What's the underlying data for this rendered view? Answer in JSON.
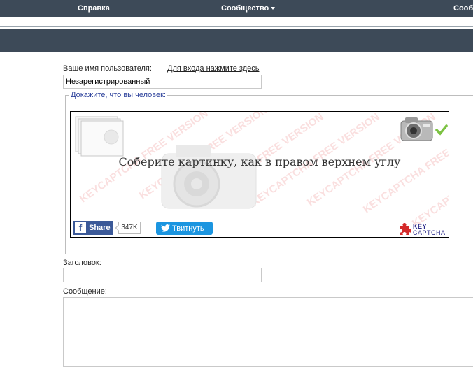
{
  "nav": {
    "items": [
      {
        "label": "Справка"
      },
      {
        "label": "Сообщество"
      },
      {
        "label": "Сооб"
      }
    ]
  },
  "form": {
    "username_label": "Ваше имя пользователя:",
    "login_link": "Для входа нажмите здесь",
    "username_value": "Незарегистрированный",
    "captcha_legend": "Докажите, что вы человек:",
    "subject_label": "Заголовок:",
    "subject_value": "",
    "message_label": "Сообщение:",
    "message_value": ""
  },
  "captcha": {
    "instruction": "Соберите картинку, как в правом верхнем углу",
    "watermark": "KEYCAPTCHA FREE VERSION",
    "share_label": "Share",
    "share_count": "347K",
    "tweet_label": "Твитнуть",
    "logo_line1": "KEY",
    "logo_line2": "CAPTCHA",
    "colors": {
      "facebook": "#3b5998",
      "twitter": "#1b95e0",
      "check": "#7cc242",
      "watermark": "#e15050"
    }
  },
  "colors": {
    "nav_bg": "#3d4a58",
    "legend_text": "#2a3f9a"
  }
}
